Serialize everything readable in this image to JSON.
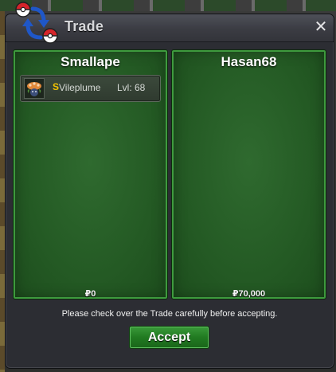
{
  "window": {
    "title": "Trade",
    "close_label": "✕"
  },
  "left_panel": {
    "player_name": "Smallape",
    "items": [
      {
        "shiny_marker": "S",
        "pokemon": "Vileplume",
        "level": "Lvl: 68"
      }
    ],
    "money": "₽0"
  },
  "right_panel": {
    "player_name": "Hasan68",
    "items": [],
    "money": "₽70,000"
  },
  "notice": "Please check over the Trade carefully before accepting.",
  "accept_label": "Accept",
  "icons": {
    "trade_logo": "trade-arrows-pokeball-icon",
    "item_icon": "vileplume-sprite-icon",
    "close": "close-icon"
  },
  "colors": {
    "panel_green": "#2f6a2f",
    "accept_green": "#217a21",
    "shiny_gold": "#f2c200"
  }
}
